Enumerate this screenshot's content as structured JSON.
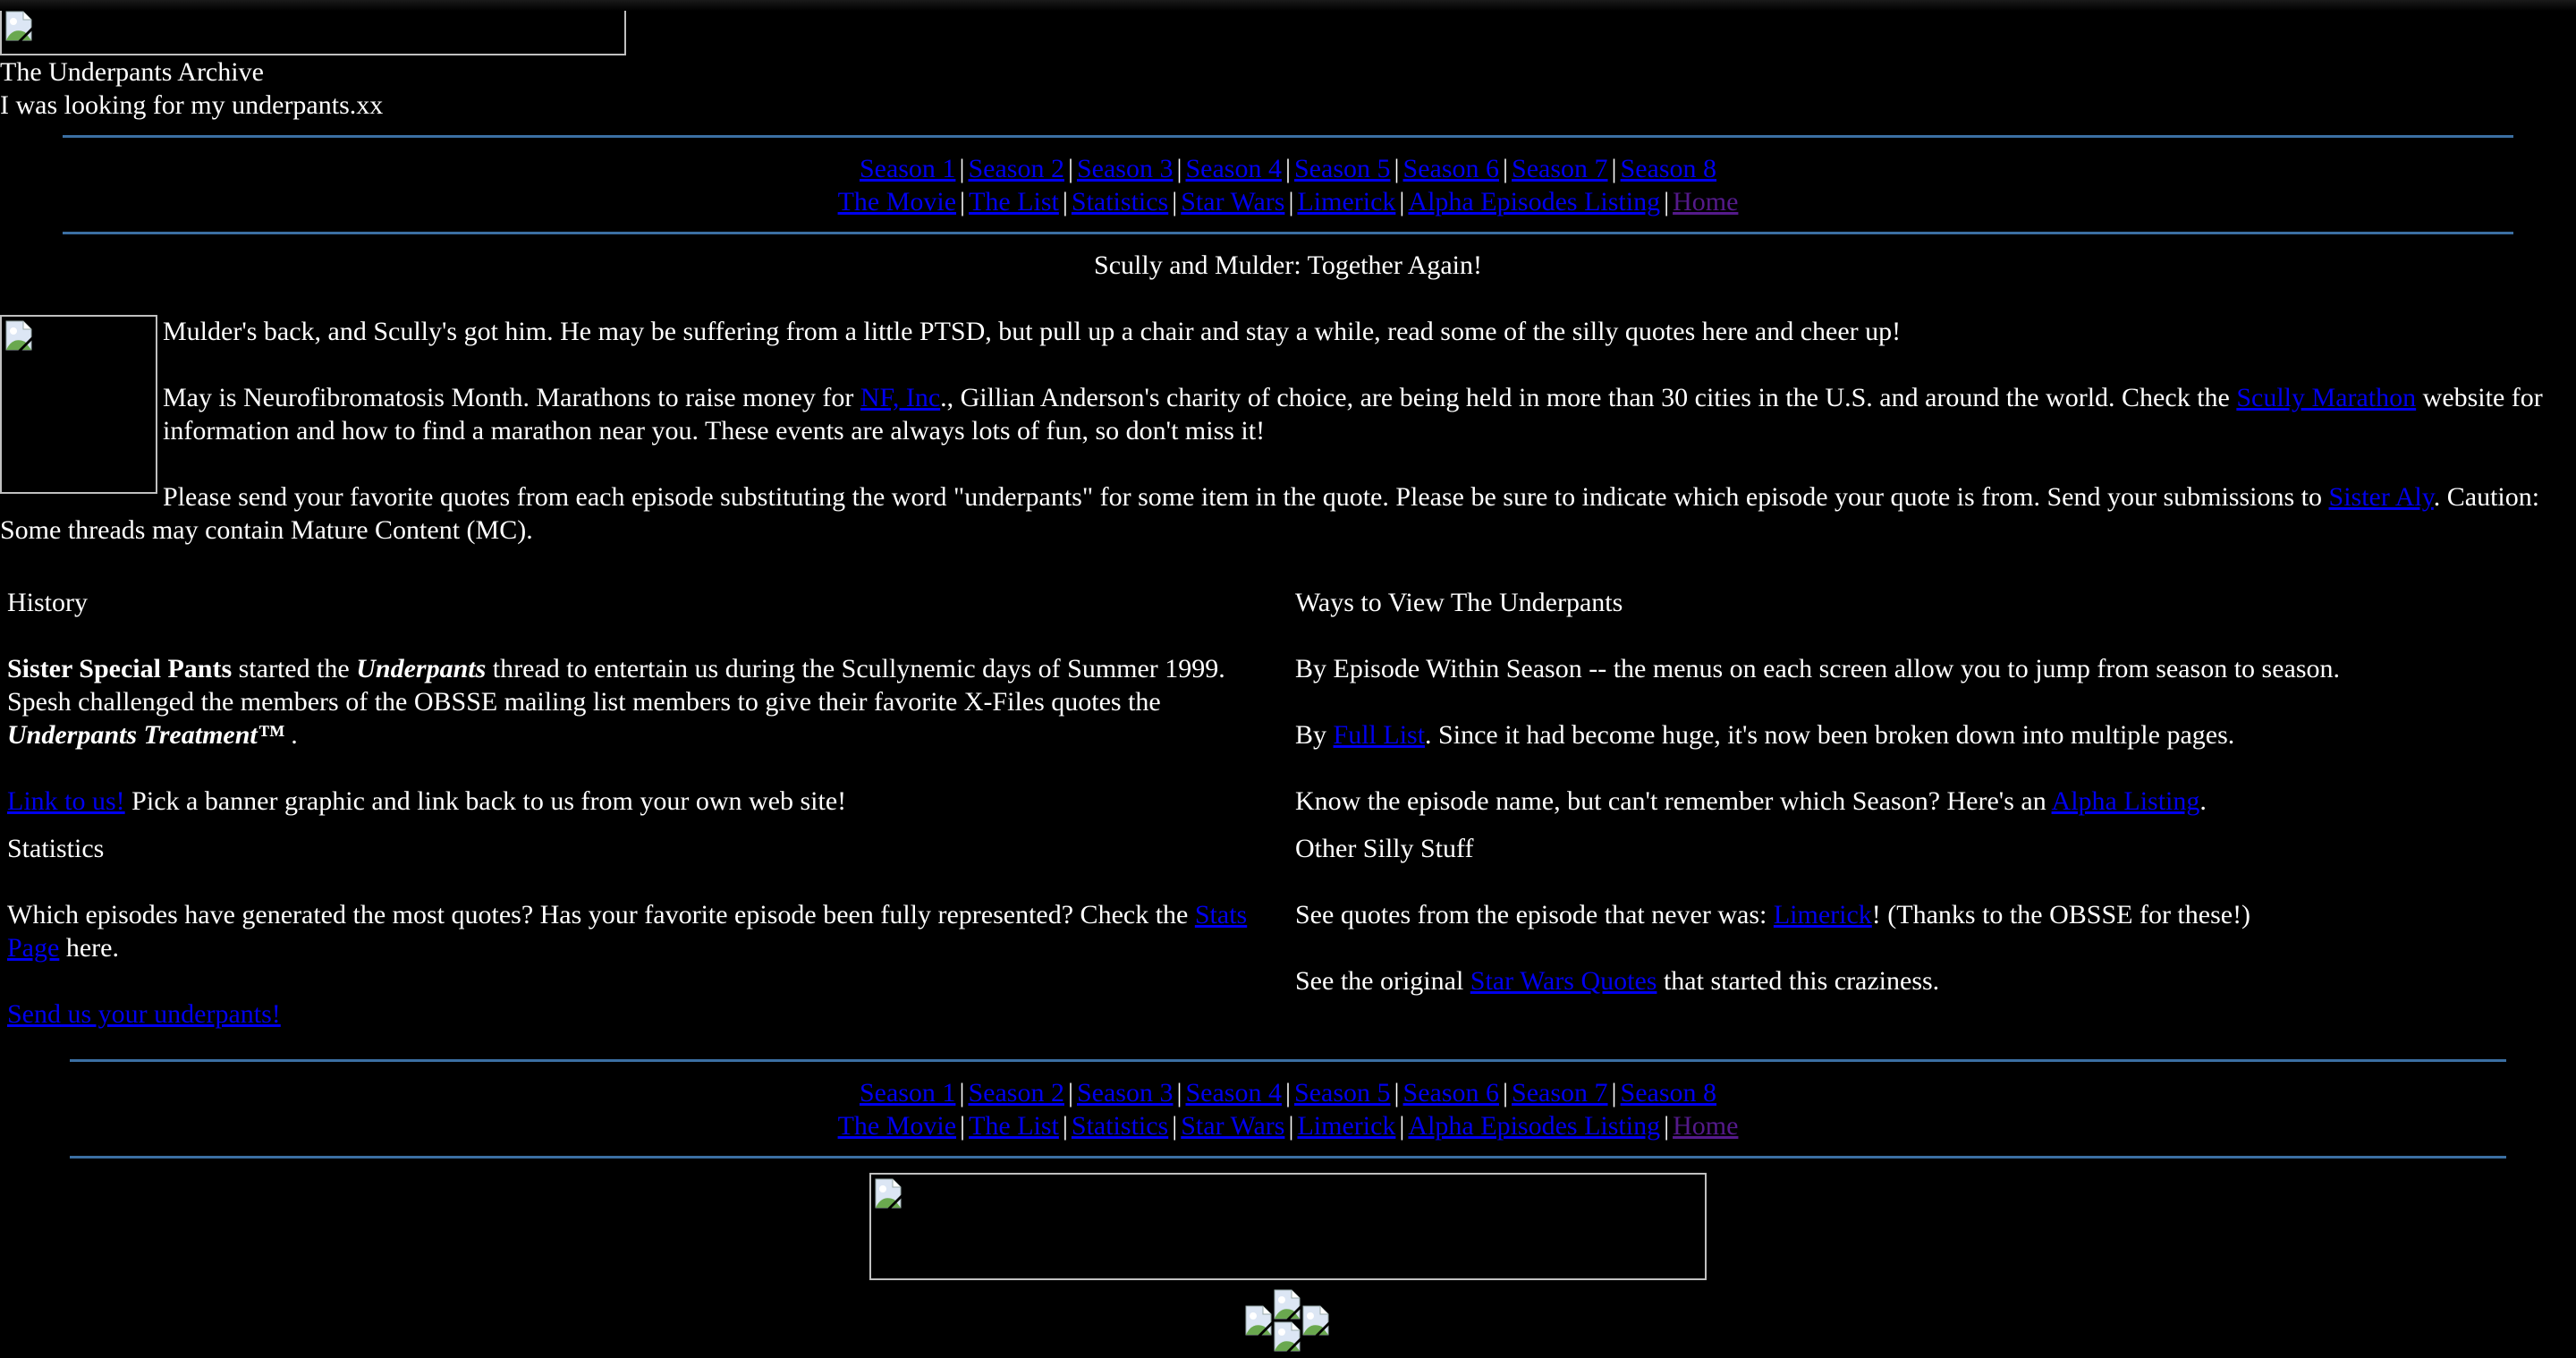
{
  "header": {
    "title": "The Underpants Archive",
    "subtitle": "I was looking for my underpants.xx"
  },
  "nav": {
    "seasons": [
      "Season 1",
      "Season 2",
      "Season 3",
      "Season 4",
      "Season 5",
      "Season 6",
      "Season 7",
      "Season 8"
    ],
    "extras": [
      "The Movie",
      "The List",
      "Statistics",
      "Star Wars",
      "Limerick",
      "Alpha Episodes Listing",
      "Home"
    ],
    "separator": "|",
    "colors": {
      "link": "#0000EE",
      "visited": "#551A8B",
      "rule": "#3B6FA3"
    }
  },
  "intro": {
    "headline": "Scully and Mulder: Together Again!",
    "p1": "Mulder's back, and Scully's got him. He may be suffering from a little PTSD, but pull up a chair and stay a while, read some of the silly quotes here and cheer up!",
    "p2_before": "May is Neurofibromatosis Month. Marathons to raise money for ",
    "p2_link1": "NF, Inc",
    "p2_middle": "., Gillian Anderson's charity of choice, are being held in more than 30 cities in the U.S. and around the world. Check the ",
    "p2_link2": "Scully Marathon",
    "p2_after": " website for information and how to find a marathon near you. These events are always lots of fun, so don't miss it!",
    "p3_before": "Please send your favorite quotes from each episode substituting the word \"underpants\" for some item in the quote. Please be sure to indicate which episode your quote is from. Send your submissions to ",
    "p3_link": "Sister Aly",
    "p3_after": ". Caution: Some threads may contain Mature Content (MC)."
  },
  "history": {
    "heading": "History",
    "bold_name": "Sister Special Pants",
    "text1": " started the ",
    "italic1": "Underpants",
    "text2": " thread to entertain us during the Scullynemic days of Summer 1999. Spesh challenged the members of the OBSSE mailing list members to give their favorite X-Files quotes the ",
    "italic2": "Underpants Treatment™",
    "text3": " .",
    "link_label": "Link to us!",
    "link_after": " Pick a banner graphic and link back to us from your own web site!"
  },
  "ways": {
    "heading": "Ways to View The Underpants",
    "p1": "By Episode Within Season -- the menus on each screen allow you to jump from season to season.",
    "p2_before": "By ",
    "p2_link": "Full List",
    "p2_after": ". Since it had become huge, it's now been broken down into multiple pages.",
    "p3_before": "Know the episode name, but can't remember which Season? Here's an ",
    "p3_link": "Alpha Listing",
    "p3_after": "."
  },
  "statistics": {
    "heading": "Statistics",
    "text": "Which episodes have generated the most quotes? Has your favorite episode been fully represented? Check the ",
    "link": "Stats Page",
    "after": " here.",
    "send_link": "Send us your underpants!"
  },
  "other": {
    "heading": "Other Silly Stuff",
    "p1_before": "See quotes from the episode that never was: ",
    "p1_link": "Limerick",
    "p1_after": "! (Thanks to the OBSSE for these!)",
    "p2_before": "See the original ",
    "p2_link": "Star Wars Quotes",
    "p2_after": " that started this craziness."
  },
  "images": {
    "top_banner": "broken-image",
    "intro_photo": "broken-image",
    "footer_banner": "broken-image",
    "footer_icons": [
      "broken-image",
      "broken-image",
      "broken-image",
      "broken-image"
    ]
  }
}
